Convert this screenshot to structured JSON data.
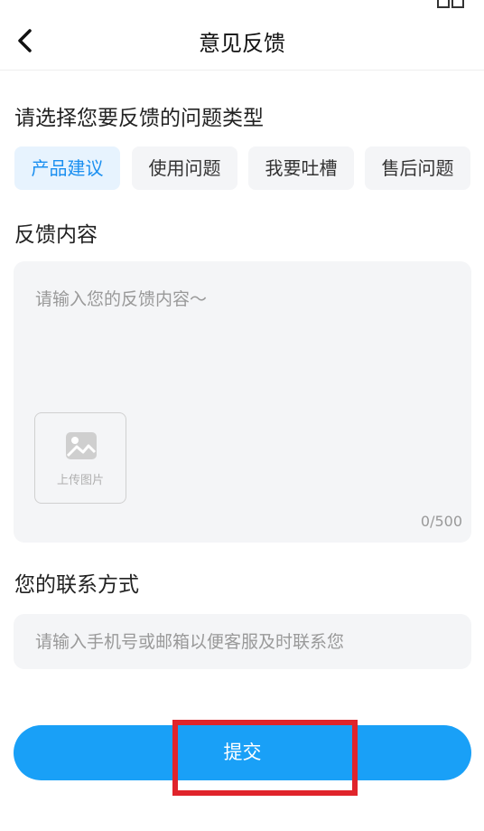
{
  "header": {
    "title": "意见反馈"
  },
  "sections": {
    "type_title": "请选择您要反馈的问题类型",
    "content_title": "反馈内容",
    "contact_title": "您的联系方式"
  },
  "types": [
    "产品建议",
    "使用问题",
    "我要吐槽",
    "售后问题"
  ],
  "selected_type": "产品建议",
  "feedback": {
    "placeholder": "请输入您的反馈内容～",
    "upload_label": "上传图片",
    "counter": "0/500"
  },
  "contact": {
    "placeholder": "请输入手机号或邮箱以便客服及时联系您"
  },
  "submit_label": "提交",
  "colors": {
    "accent": "#19a0f7",
    "selected_bg": "#e7f3fe",
    "highlight": "#e0242b"
  }
}
